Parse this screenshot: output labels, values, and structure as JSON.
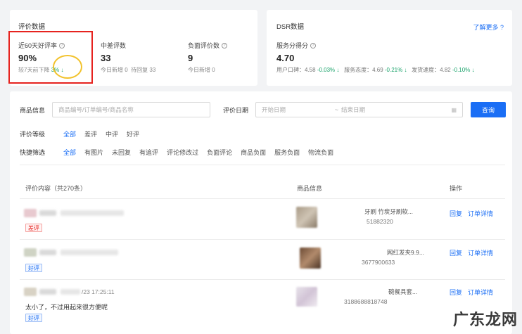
{
  "eval": {
    "title": "评价数据",
    "good_rate": {
      "label": "近60天好评率",
      "value": "90%",
      "compare_label": "较7天前下降",
      "compare_value": "3%"
    },
    "mid_bad": {
      "label": "中差评数",
      "value": "33",
      "new_label": "今日新增",
      "new_value": "0",
      "pending_label": "待回复",
      "pending_value": "33"
    },
    "negative": {
      "label": "负面评价数",
      "value": "9",
      "new_label": "今日新增",
      "new_value": "0"
    }
  },
  "dsr": {
    "title": "DSR数据",
    "more_link": "了解更多 ?",
    "service": {
      "label": "服务分得分",
      "value": "4.70"
    },
    "items": [
      {
        "label": "用户口碑：",
        "value": "4.58",
        "delta": "-0.03%"
      },
      {
        "label": "服务态度：",
        "value": "4.69",
        "delta": "-0.21%"
      },
      {
        "label": "发货速度：",
        "value": "4.82",
        "delta": "-0.10%"
      }
    ]
  },
  "search": {
    "product_label": "商品信息",
    "product_placeholder": "商品编号/订单编号/商品名称",
    "date_label": "评价日期",
    "start_placeholder": "开始日期",
    "tilde": "~",
    "end_placeholder": "结束日期",
    "query_button": "查询"
  },
  "filters": {
    "level_label": "评价等级",
    "levels": [
      "全部",
      "差评",
      "中评",
      "好评"
    ],
    "quick_label": "快捷筛选",
    "quick": [
      "全部",
      "有图片",
      "未回复",
      "有追评",
      "评论修改过",
      "负面评论",
      "商品负面",
      "服务负面",
      "物流负面"
    ]
  },
  "table": {
    "headers": {
      "content": "评价内容（共270条）",
      "product": "商品信息",
      "ops": "操作"
    },
    "rows": [
      {
        "tag": "差评",
        "date": "",
        "text": "",
        "product_name": "牙刷 竹炭牙刷软...",
        "product_id": "51882320",
        "reply": "回复",
        "detail": "订单详情"
      },
      {
        "tag": "好评",
        "date": "",
        "text": "",
        "product_name": "网红发夹9.9...",
        "product_id": "3677900633",
        "reply": "回复",
        "detail": "订单详情"
      },
      {
        "tag": "好评",
        "date": "/23 17:25:11",
        "text": "太小了，不过用起来很方便呢",
        "product_name": "碗餐具套...",
        "product_id": "3188688818748",
        "reply": "回复",
        "detail": "订单详情"
      }
    ]
  },
  "watermark": "广东龙网"
}
